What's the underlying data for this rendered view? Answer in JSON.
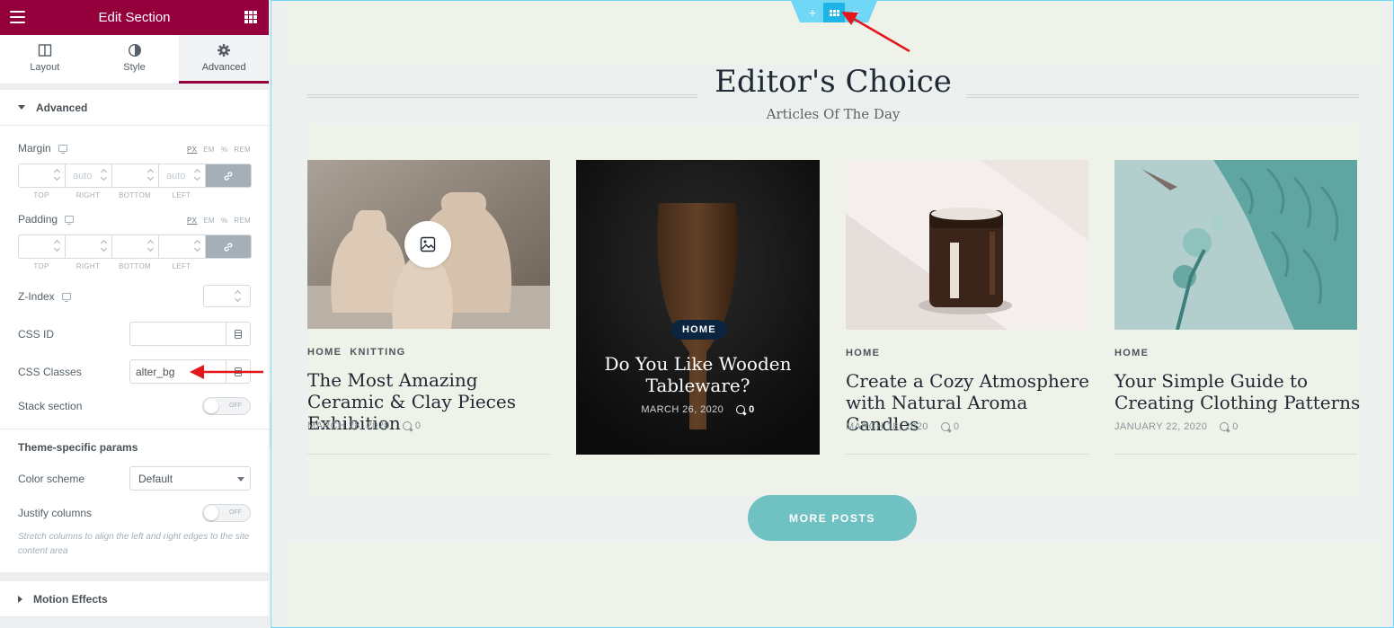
{
  "sidebar": {
    "title": "Edit Section",
    "tabs": [
      {
        "label": "Layout"
      },
      {
        "label": "Style"
      },
      {
        "label": "Advanced"
      }
    ],
    "advanced_section": {
      "heading": "Advanced",
      "margin": {
        "label": "Margin",
        "units": [
          "PX",
          "EM",
          "%",
          "REM"
        ],
        "values": [
          "",
          "auto",
          "",
          "auto"
        ],
        "sides": [
          "TOP",
          "RIGHT",
          "BOTTOM",
          "LEFT"
        ]
      },
      "padding": {
        "label": "Padding",
        "units": [
          "PX",
          "EM",
          "%",
          "REM"
        ],
        "values": [
          "",
          "",
          "",
          ""
        ],
        "sides": [
          "TOP",
          "RIGHT",
          "BOTTOM",
          "LEFT"
        ]
      },
      "z_index": {
        "label": "Z-Index",
        "value": ""
      },
      "css_id": {
        "label": "CSS ID",
        "value": ""
      },
      "css_classes": {
        "label": "CSS Classes",
        "value": "alter_bg"
      },
      "stack_section": {
        "label": "Stack section",
        "state": "OFF"
      }
    },
    "theme_params": {
      "heading": "Theme-specific params",
      "color_scheme": {
        "label": "Color scheme",
        "value": "Default"
      },
      "justify_columns": {
        "label": "Justify columns",
        "state": "OFF"
      },
      "description": "Stretch columns to align the left and right edges to the site content area"
    },
    "motion_effects": {
      "heading": "Motion Effects"
    }
  },
  "preview": {
    "heading": "Editor's Choice",
    "subheading": "Articles Of The Day",
    "posts": [
      {
        "categories": [
          "HOME",
          "KNITTING"
        ],
        "title": "The Most Amazing Ceramic & Clay Pieces Exhibition",
        "date": "MARCH 28, 2020",
        "comments": "0"
      },
      {
        "categories": [
          "HOME"
        ],
        "title": "Do You Like Wooden Tableware?",
        "date": "MARCH 26, 2020",
        "comments": "0"
      },
      {
        "categories": [
          "HOME"
        ],
        "title": "Create a Cozy Atmosphere with Natural Aroma Candles",
        "date": "MARCH 18, 2020",
        "comments": "0"
      },
      {
        "categories": [
          "HOME"
        ],
        "title": "Your Simple Guide to Creating Clothing Patterns",
        "date": "JANUARY 22, 2020",
        "comments": "0"
      }
    ],
    "more_button": "MORE POSTS",
    "section_handle": {
      "add": "+",
      "close": "×"
    }
  },
  "colors": {
    "brand": "#93003c",
    "editor_accent": "#71d7f7",
    "button": "#6fc1c2",
    "annotation_arrow": "#e3161b"
  }
}
